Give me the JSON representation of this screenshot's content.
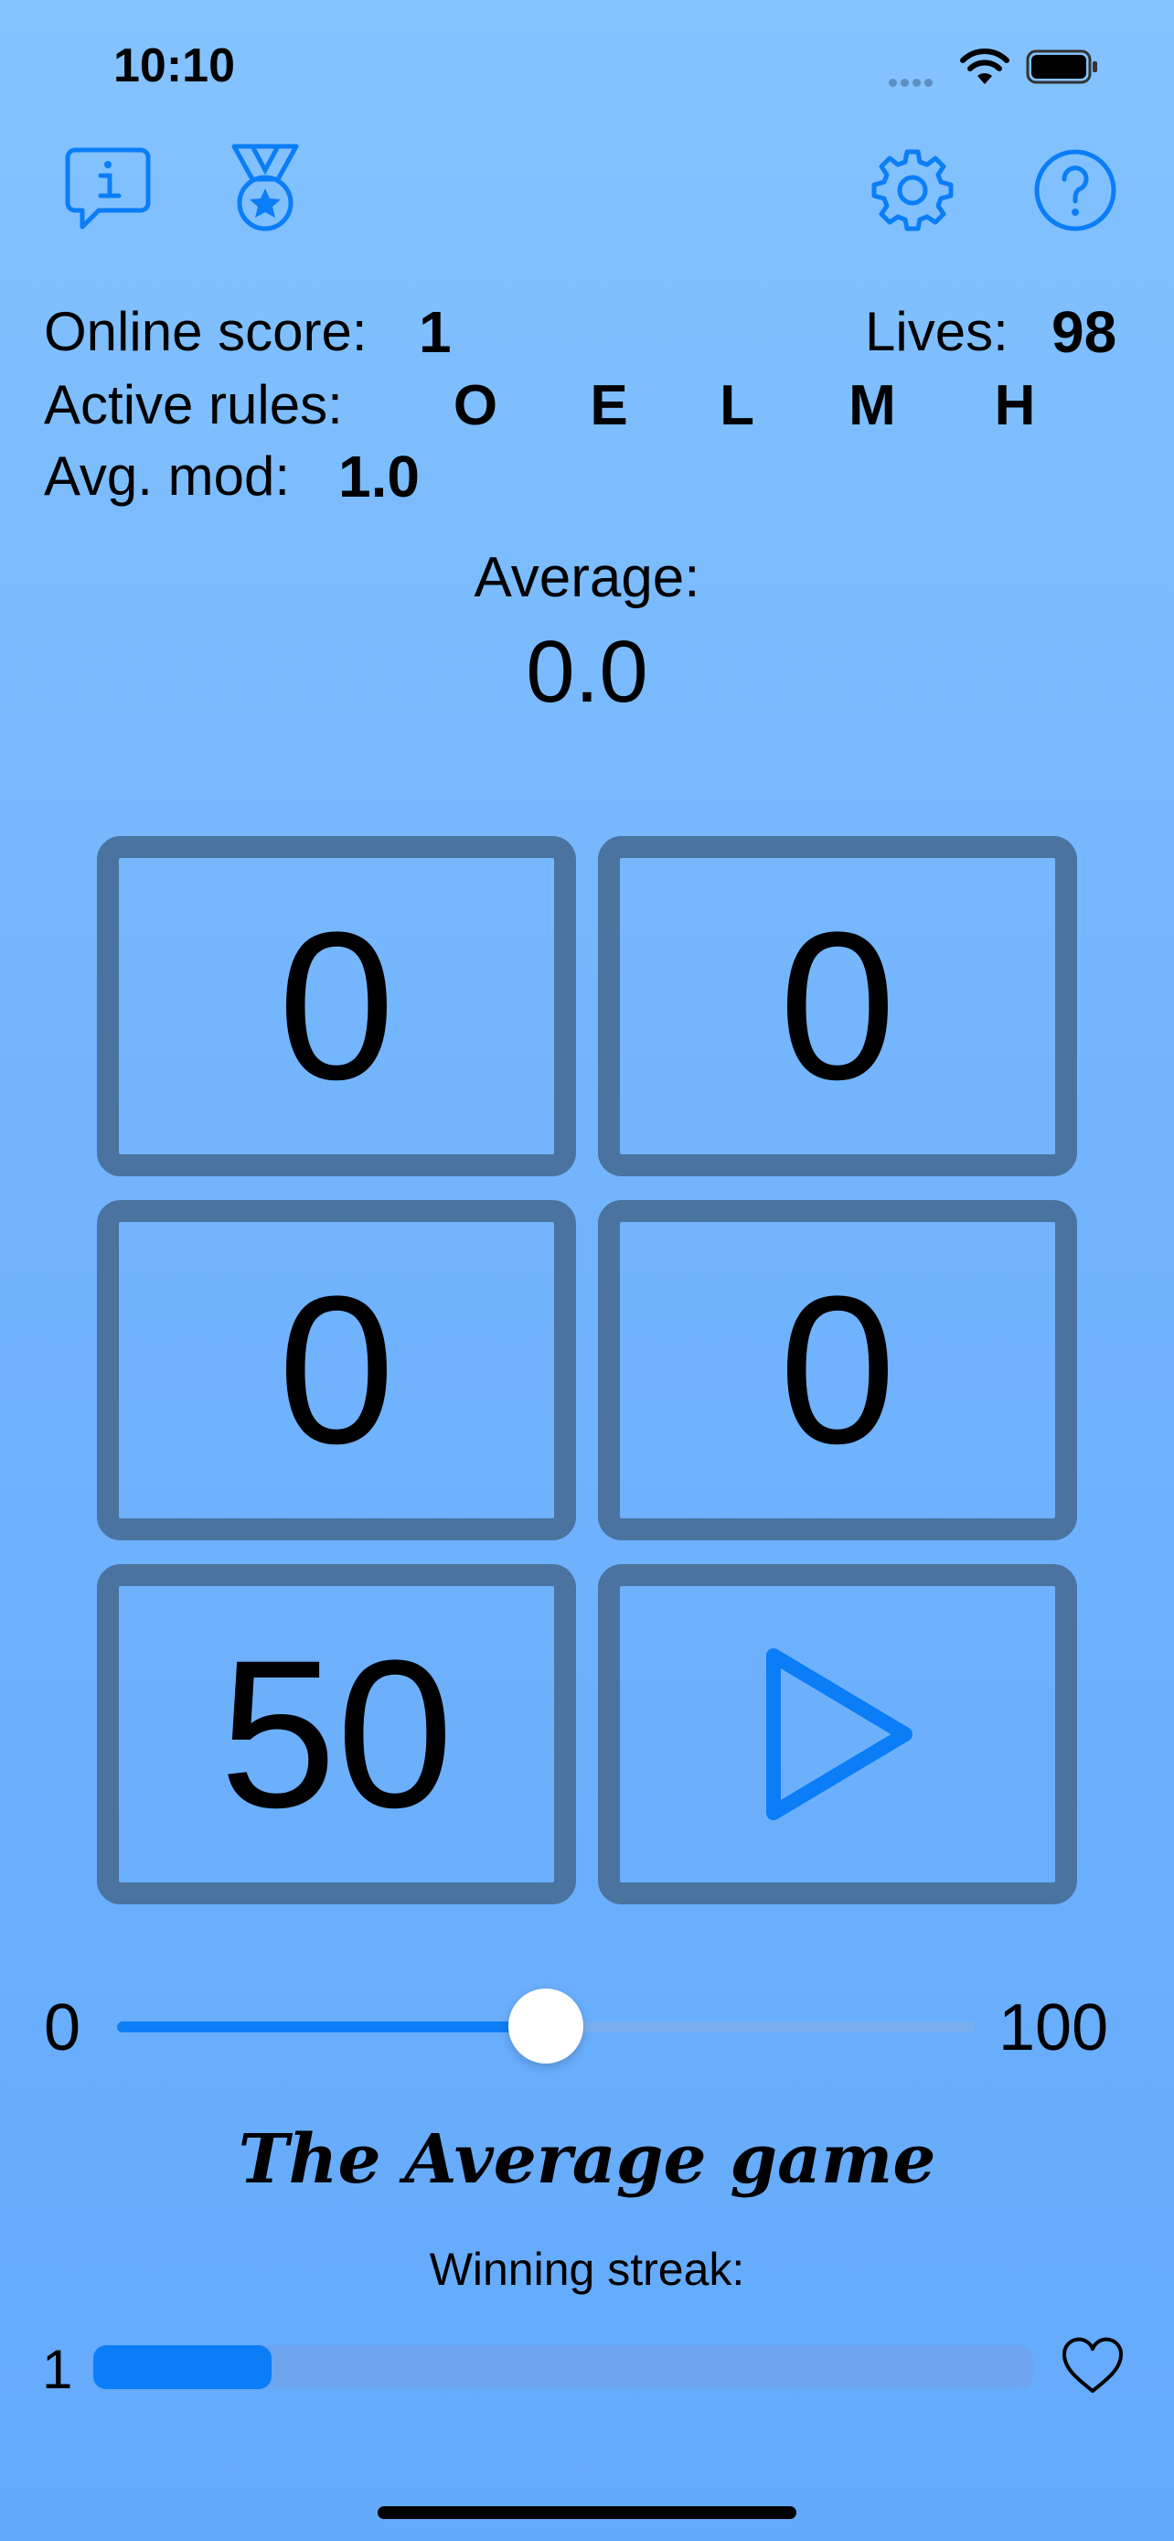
{
  "status_bar": {
    "time": "10:10"
  },
  "icons": {
    "info": "info-bubble-icon",
    "medal": "medal-icon",
    "settings": "gear-icon",
    "help": "question-circle-icon",
    "play": "play-icon",
    "heart": "heart-icon",
    "wifi": "wifi-icon",
    "battery": "battery-icon"
  },
  "info": {
    "online_score_label": "Online score:",
    "online_score_value": "1",
    "lives_label": "Lives:",
    "lives_value": "98",
    "active_rules_label": "Active rules:",
    "rules": [
      "O",
      "E",
      "L",
      "M",
      "H"
    ],
    "avg_mod_label": "Avg. mod:",
    "avg_mod_value": "1.0"
  },
  "average": {
    "label": "Average:",
    "value": "0.0"
  },
  "tiles": [
    "0",
    "0",
    "0",
    "0",
    "50"
  ],
  "slider": {
    "min_label": "0",
    "max_label": "100",
    "value": 50,
    "min": 0,
    "max": 100
  },
  "game_title": "The Average game",
  "streak": {
    "label": "Winning streak:",
    "count": "1",
    "progress_fraction": 0.19
  },
  "colors": {
    "accent": "#0b7df7",
    "tile_border": "#4a73a0",
    "background_top": "#84c3fe",
    "background_bottom": "#64aafc"
  }
}
